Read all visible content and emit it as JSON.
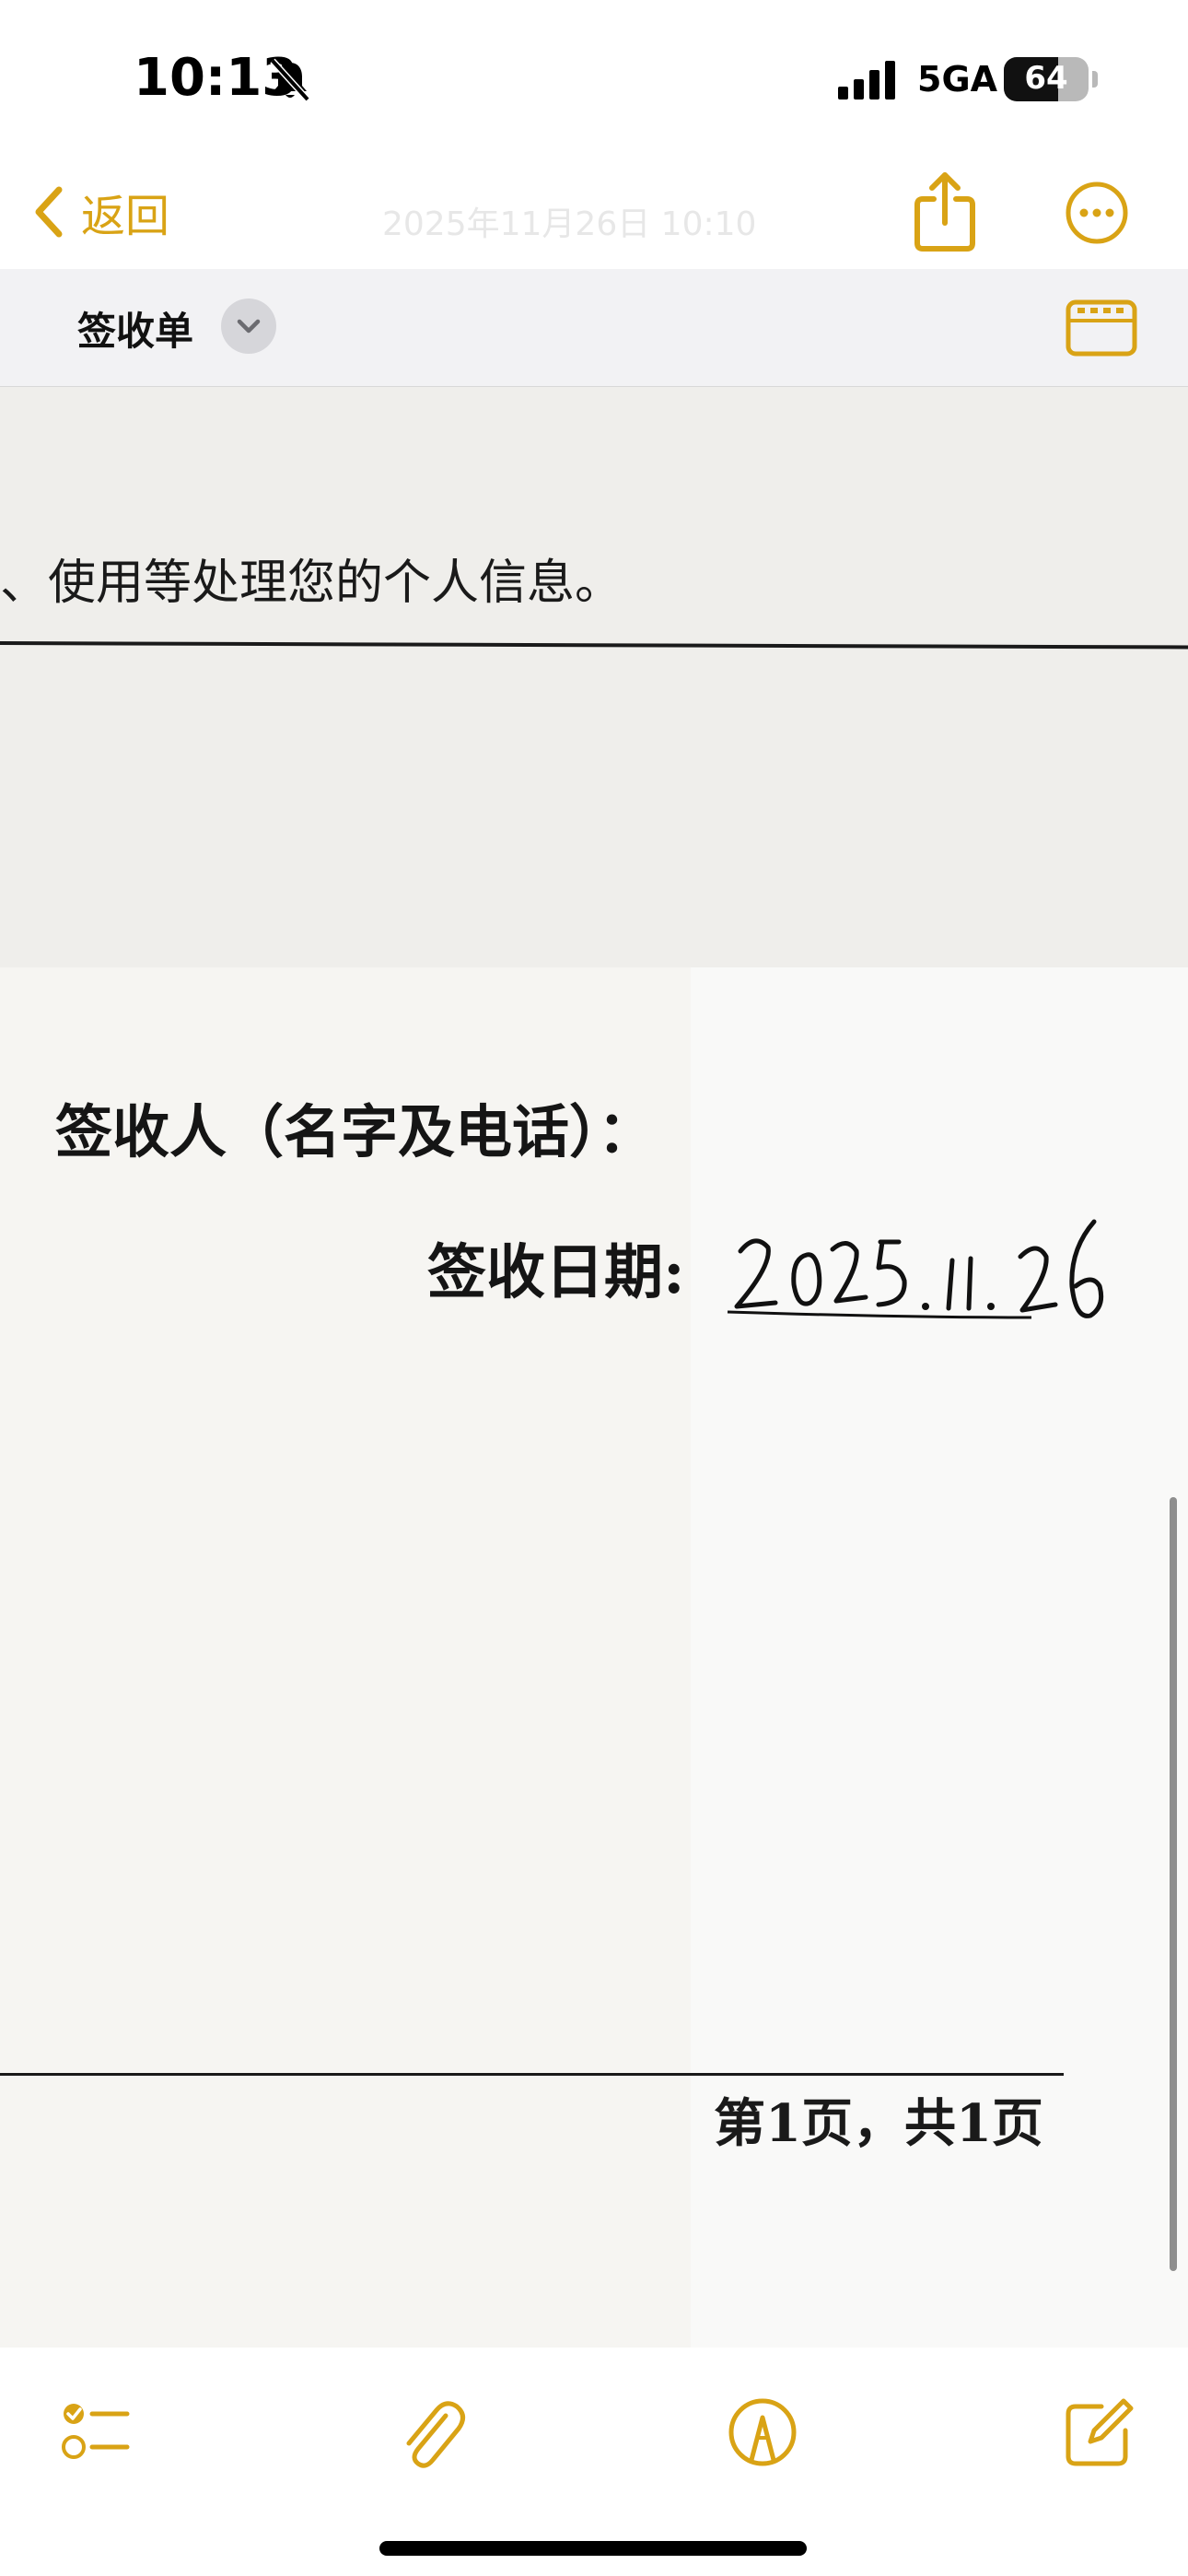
{
  "status_bar": {
    "time": "10:13",
    "network": "5GA",
    "battery_level": "64",
    "battery_fraction": 0.64,
    "icons": [
      "bell-slash-icon",
      "cellular-signal-icon",
      "battery-icon"
    ]
  },
  "nav": {
    "back_label": "返回",
    "date_text": "2025年11月26日 10:10",
    "share_icon": "share-icon",
    "more_icon": "ellipsis-circle-icon",
    "accent_color": "#d9a315"
  },
  "title_bar": {
    "title": "签收单",
    "dropdown_icon": "chevron-down-icon",
    "keyboard_icon": "keyboard-icon"
  },
  "document": {
    "consent_text": "、使用等处理您的个人信息。",
    "signer_label": "签收人（名字及电话）：",
    "date_label": "签收日期:",
    "handwritten_date": "2025.11.26",
    "page_footer": "第1页，共1页"
  },
  "toolbar": {
    "icons": [
      "checklist-icon",
      "paperclip-icon",
      "markup-pen-icon",
      "compose-icon"
    ]
  }
}
